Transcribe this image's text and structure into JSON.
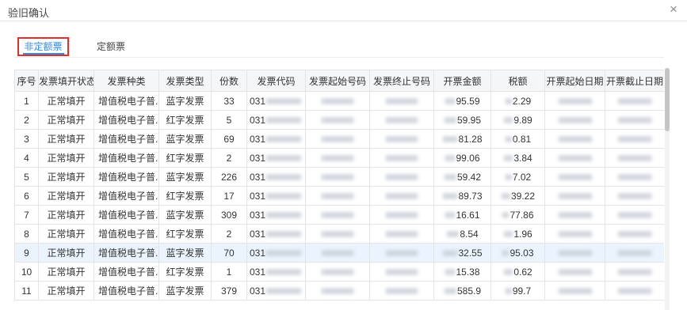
{
  "dialog": {
    "title": "验旧确认",
    "close_label": "×"
  },
  "tabs": [
    {
      "label": "非定额票",
      "active": true
    },
    {
      "label": "定额票",
      "active": false
    }
  ],
  "colors": {
    "accent": "#2d8cf0",
    "highlight_box": "#e0302b",
    "hover_row": "#ebf4fe",
    "header_bg": "#f5f6f8"
  },
  "table": {
    "columns": [
      "序号",
      "发票填开状态",
      "发票种类",
      "发票类型",
      "份数",
      "发票代码",
      "发票起始号码",
      "发票终止号码",
      "开票金额",
      "税额",
      "开票起始日期",
      "开票截止日期"
    ],
    "rows": [
      {
        "index": "1",
        "status": "正常填开",
        "kind": "增值税电子普...",
        "type": "蓝字发票",
        "count": "33",
        "code": "031",
        "amount": "95.59",
        "tax": "2.29",
        "highlighted": false
      },
      {
        "index": "2",
        "status": "正常填开",
        "kind": "增值税电子普...",
        "type": "红字发票",
        "count": "5",
        "code": "031",
        "amount": "59.95",
        "tax": "9.89",
        "highlighted": false
      },
      {
        "index": "3",
        "status": "正常填开",
        "kind": "增值税电子普...",
        "type": "蓝字发票",
        "count": "69",
        "code": "031",
        "amount": "81.28",
        "tax": "0.81",
        "highlighted": false
      },
      {
        "index": "4",
        "status": "正常填开",
        "kind": "增值税电子普...",
        "type": "红字发票",
        "count": "2",
        "code": "031",
        "amount": "99.06",
        "tax": "3.84",
        "highlighted": false
      },
      {
        "index": "5",
        "status": "正常填开",
        "kind": "增值税电子普...",
        "type": "蓝字发票",
        "count": "226",
        "code": "031",
        "amount": "59.42",
        "tax": "7.02",
        "highlighted": false
      },
      {
        "index": "6",
        "status": "正常填开",
        "kind": "增值税电子普...",
        "type": "红字发票",
        "count": "17",
        "code": "031",
        "amount": "89.73",
        "tax": "39.22",
        "highlighted": false
      },
      {
        "index": "7",
        "status": "正常填开",
        "kind": "增值税电子普...",
        "type": "蓝字发票",
        "count": "309",
        "code": "031",
        "amount": "16.61",
        "tax": "77.86",
        "highlighted": false
      },
      {
        "index": "8",
        "status": "正常填开",
        "kind": "增值税电子普...",
        "type": "红字发票",
        "count": "2",
        "code": "031",
        "amount": "8.54",
        "tax": "1.96",
        "highlighted": false
      },
      {
        "index": "9",
        "status": "正常填开",
        "kind": "增值税电子普...",
        "type": "蓝字发票",
        "count": "70",
        "code": "031",
        "amount": "32.55",
        "tax": "95.03",
        "highlighted": true
      },
      {
        "index": "10",
        "status": "正常填开",
        "kind": "增值税电子普...",
        "type": "红字发票",
        "count": "1",
        "code": "031",
        "amount": "15.38",
        "tax": "0.62",
        "highlighted": false
      },
      {
        "index": "11",
        "status": "正常填开",
        "kind": "增值税电子普...",
        "type": "蓝字发票",
        "count": "379",
        "code": "031",
        "amount": "585.9",
        "tax": "99.7",
        "highlighted": false
      }
    ]
  }
}
